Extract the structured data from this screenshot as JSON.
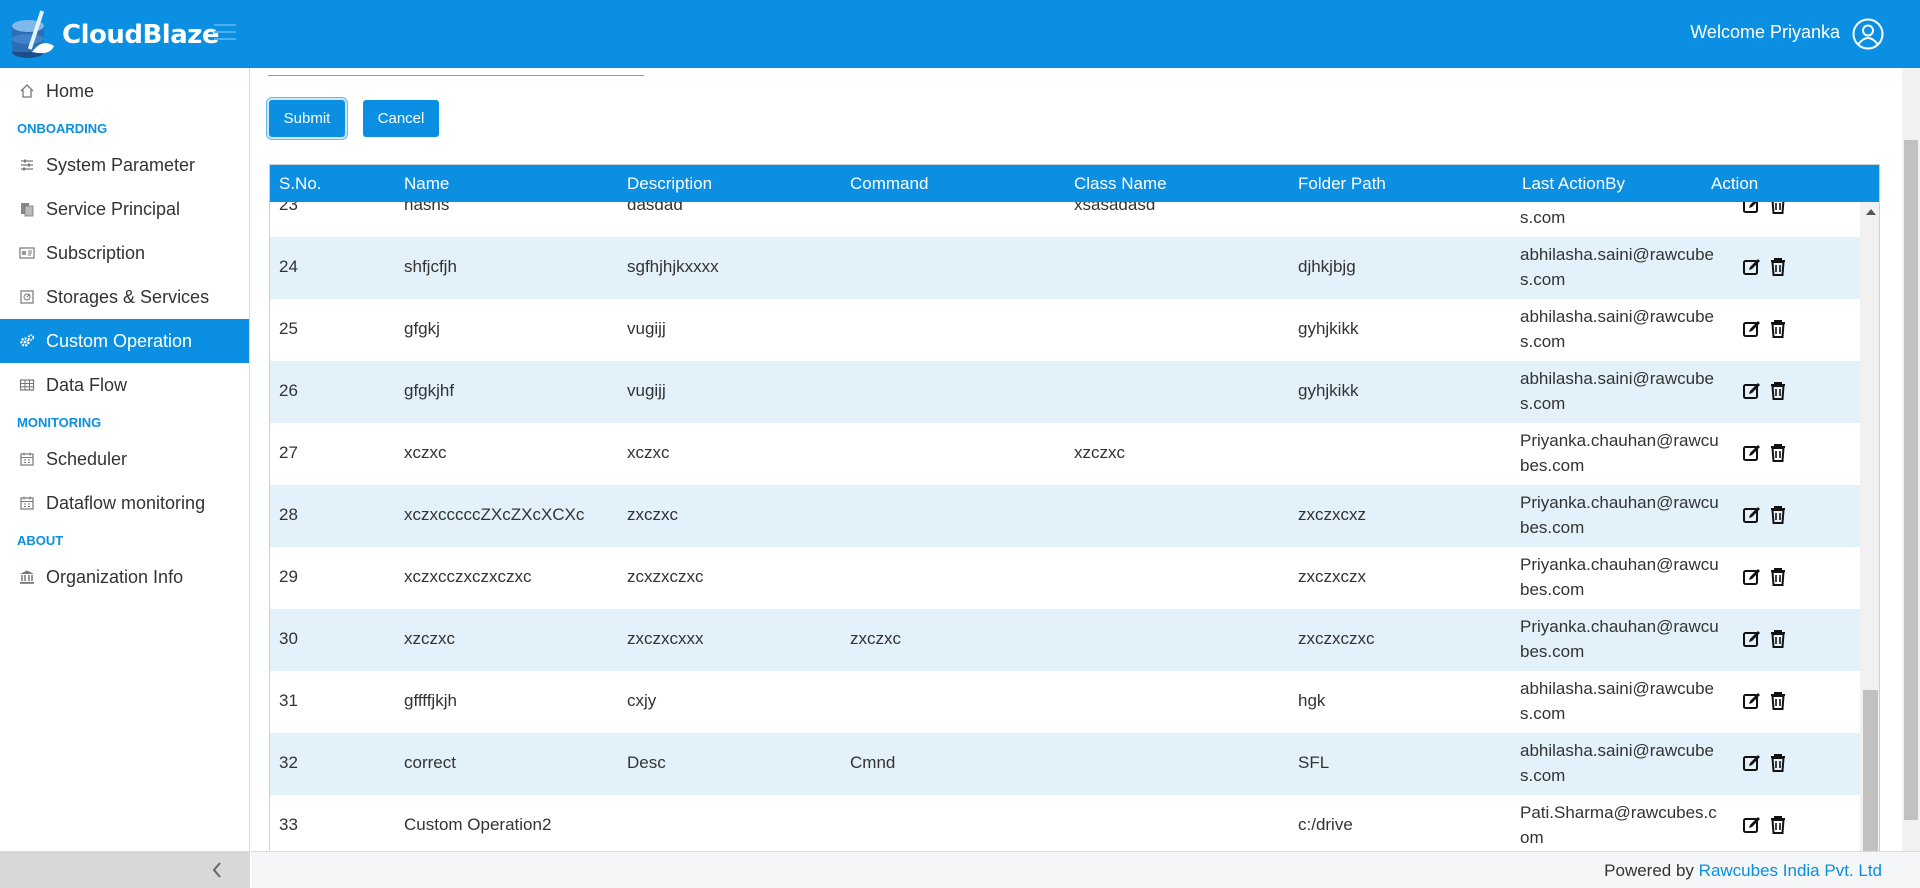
{
  "app": {
    "brand": "CloudBlaze",
    "welcome": "Welcome Priyanka",
    "colors": {
      "primary": "#0a8fe2",
      "active": "#0a8fe2",
      "row_alt": "#e3f1fb"
    }
  },
  "sidebar": {
    "home": "Home",
    "section_onboarding": "ONBOARDING",
    "system_parameter": "System Parameter",
    "service_principal": "Service Principal",
    "subscription": "Subscription",
    "storages_services": "Storages & Services",
    "custom_operation": "Custom Operation",
    "data_flow": "Data Flow",
    "section_monitoring": "MONITORING",
    "scheduler": "Scheduler",
    "dataflow_monitoring": "Dataflow monitoring",
    "section_about": "ABOUT",
    "organization_info": "Organization Info"
  },
  "form": {
    "submit_label": "Submit",
    "cancel_label": "Cancel"
  },
  "table": {
    "headers": [
      "S.No.",
      "Name",
      "Description",
      "Command",
      "Class Name",
      "Folder Path",
      "Last ActionBy",
      "Action"
    ],
    "rows": [
      {
        "sno": "23",
        "name": "hashs",
        "description": "dasdad",
        "command": "",
        "class_name": "xsasadasd",
        "folder_path": "",
        "email_top": "",
        "email_bottom": "s.com"
      },
      {
        "sno": "24",
        "name": "shfjcfjh",
        "description": "sgfhjhjkxxxx",
        "command": "",
        "class_name": "",
        "folder_path": "djhkjbjg",
        "email_top": "abhilasha.saini@rawcube",
        "email_bottom": "s.com"
      },
      {
        "sno": "25",
        "name": "gfgkj",
        "description": "vugijj",
        "command": "",
        "class_name": "",
        "folder_path": "gyhjkikk",
        "email_top": "abhilasha.saini@rawcube",
        "email_bottom": "s.com"
      },
      {
        "sno": "26",
        "name": "gfgkjhf",
        "description": "vugijj",
        "command": "",
        "class_name": "",
        "folder_path": "gyhjkikk",
        "email_top": "abhilasha.saini@rawcube",
        "email_bottom": "s.com"
      },
      {
        "sno": "27",
        "name": "xczxc",
        "description": "xczxc",
        "command": "",
        "class_name": "xzczxc",
        "folder_path": "",
        "email_top": "Priyanka.chauhan@rawcu",
        "email_bottom": "bes.com"
      },
      {
        "sno": "28",
        "name": "xczxcccccZXcZXcXCXc",
        "description": "zxczxc",
        "command": "",
        "class_name": "",
        "folder_path": "zxczxcxz",
        "email_top": "Priyanka.chauhan@rawcu",
        "email_bottom": "bes.com"
      },
      {
        "sno": "29",
        "name": "xczxcczxczxczxc",
        "description": "zcxzxczxc",
        "command": "",
        "class_name": "",
        "folder_path": "zxczxczx",
        "email_top": "Priyanka.chauhan@rawcu",
        "email_bottom": "bes.com"
      },
      {
        "sno": "30",
        "name": "xzczxc",
        "description": "zxczxcxxx",
        "command": "zxczxc",
        "class_name": "",
        "folder_path": "zxczxczxc",
        "email_top": "Priyanka.chauhan@rawcu",
        "email_bottom": "bes.com"
      },
      {
        "sno": "31",
        "name": "gffffjkjh",
        "description": "cxjy",
        "command": "",
        "class_name": "",
        "folder_path": "hgk",
        "email_top": "abhilasha.saini@rawcube",
        "email_bottom": "s.com"
      },
      {
        "sno": "32",
        "name": "correct",
        "description": "Desc",
        "command": "Cmnd",
        "class_name": "",
        "folder_path": "SFL",
        "email_top": "abhilasha.saini@rawcube",
        "email_bottom": "s.com"
      },
      {
        "sno": "33",
        "name": "Custom Operation2",
        "description": "",
        "command": "",
        "class_name": "",
        "folder_path": "c:/drive",
        "email_top": "Pati.Sharma@rawcubes.c",
        "email_bottom": "om"
      }
    ]
  },
  "footer": {
    "powered_by": "Powered by",
    "company": "Rawcubes India Pvt. Ltd"
  }
}
